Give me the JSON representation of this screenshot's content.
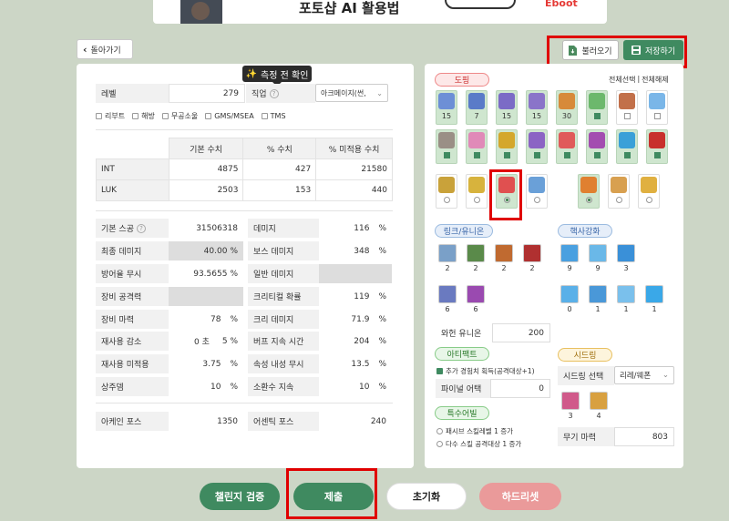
{
  "banner": {
    "title": "포토샵 AI 활용법"
  },
  "nav": {
    "back_label": "돌아가기"
  },
  "toolbar": {
    "load_label": "불러오기",
    "save_label": "저장하기"
  },
  "tooltip": {
    "text": "측정 전 확인"
  },
  "char": {
    "level_label": "레벨",
    "level_value": "279",
    "job_label": "직업",
    "job_value": "아크메이지(썬,",
    "options": [
      "리부트",
      "해방",
      "무공소울",
      "GMS/MSEA",
      "TMS"
    ]
  },
  "stats_table": {
    "headers": [
      "",
      "기본 수치",
      "% 수치",
      "% 미적용 수치"
    ],
    "rows": [
      {
        "name": "INT",
        "base": "4875",
        "pct": "427",
        "flat": "21580"
      },
      {
        "name": "LUK",
        "base": "2503",
        "pct": "153",
        "flat": "440"
      }
    ]
  },
  "left_stats": [
    {
      "label": "기본 스공",
      "value": "31506318",
      "unit": ""
    },
    {
      "label": "최종 데미지",
      "value": "40.00",
      "unit": "%"
    },
    {
      "label": "방어율 무시",
      "value": "93.5655",
      "unit": "%"
    },
    {
      "label": "장비 공격력",
      "value": "",
      "unit": ""
    },
    {
      "label": "장비 마력",
      "value": "78",
      "unit": "%"
    },
    {
      "label": "재사용 감소",
      "value": "0 초",
      "unit": "5 %"
    },
    {
      "label": "재사용 미적용",
      "value": "3.75",
      "unit": "%"
    },
    {
      "label": "상주뎀",
      "value": "10",
      "unit": "%"
    }
  ],
  "right_stats": [
    {
      "label": "데미지",
      "value": "116",
      "unit": "%"
    },
    {
      "label": "보스 데미지",
      "value": "348",
      "unit": "%"
    },
    {
      "label": "일반 데미지",
      "value": "",
      "unit": ""
    },
    {
      "label": "크리티컬 확률",
      "value": "119",
      "unit": "%"
    },
    {
      "label": "크리 데미지",
      "value": "71.9",
      "unit": "%"
    },
    {
      "label": "버프 지속 시간",
      "value": "204",
      "unit": "%"
    },
    {
      "label": "속성 내성 무시",
      "value": "13.5",
      "unit": "%"
    },
    {
      "label": "소환수 지속",
      "value": "10",
      "unit": "%"
    }
  ],
  "force": {
    "arcane_label": "아케인 포스",
    "arcane_value": "1350",
    "authentic_label": "어센틱 포스",
    "authentic_value": "240"
  },
  "doping": {
    "title": "도핑",
    "select_all": "전체선택",
    "sep": "|",
    "deselect_all": "전체해제",
    "row1": [
      {
        "icon": "scroll-icon",
        "count": "15",
        "on": true,
        "color": "#6d8fd6"
      },
      {
        "icon": "scroll-icon",
        "count": "7",
        "on": true,
        "color": "#5a7bc8"
      },
      {
        "icon": "scroll-icon",
        "count": "15",
        "on": true,
        "color": "#7b6bc6"
      },
      {
        "icon": "scroll-icon",
        "count": "15",
        "on": true,
        "color": "#8a74c9"
      },
      {
        "icon": "potion-icon",
        "count": "30",
        "on": true,
        "color": "#d78a3a"
      },
      {
        "icon": "orb-icon",
        "count": "",
        "on": true,
        "color": "#6cb86c"
      },
      {
        "icon": "flower-icon",
        "count": "",
        "on": false,
        "color": "#c2704a"
      },
      {
        "icon": "snow-icon",
        "count": "",
        "on": false,
        "color": "#7ab6e8"
      }
    ],
    "row2": [
      {
        "icon": "armor-icon",
        "on": true,
        "color": "#9a8f86"
      },
      {
        "icon": "pink-icon",
        "on": true,
        "color": "#e08ab8"
      },
      {
        "icon": "gold-icon",
        "on": true,
        "color": "#d4a72c"
      },
      {
        "icon": "box-icon",
        "on": true,
        "color": "#8b64c4"
      },
      {
        "icon": "heart-icon",
        "on": true,
        "color": "#e05a5a"
      },
      {
        "icon": "flask-icon",
        "on": true,
        "color": "#a34db0"
      },
      {
        "icon": "crystal-icon",
        "on": true,
        "color": "#3aa0d8"
      },
      {
        "icon": "vip-icon",
        "on": true,
        "color": "#c8302c"
      }
    ],
    "row3": [
      {
        "icon": "feather-icon",
        "on": false,
        "color": "#c9a23a"
      },
      {
        "icon": "sword-icon",
        "on": false,
        "color": "#d7b33d"
      },
      {
        "icon": "target-icon",
        "on": true,
        "color": "#e05050"
      },
      {
        "icon": "potion-icon",
        "on": false,
        "color": "#6aa0d8"
      },
      {
        "icon": "fish-icon",
        "on": true,
        "color": "#e08030"
      },
      {
        "icon": "rocket-icon",
        "on": false,
        "color": "#d8a050"
      },
      {
        "icon": "bird-icon",
        "on": false,
        "color": "#e0b040"
      }
    ]
  },
  "link": {
    "title": "링크/유니온",
    "row1": [
      {
        "count": "2",
        "color": "#7aa0c8"
      },
      {
        "count": "2",
        "color": "#5a8a4a"
      },
      {
        "count": "2",
        "color": "#c06a30"
      },
      {
        "count": "2",
        "color": "#b03030"
      }
    ],
    "row2": [
      {
        "count": "6",
        "color": "#6a7ac0"
      },
      {
        "count": "6",
        "color": "#9a4ab0"
      }
    ],
    "union_label": "와헌 유니온",
    "union_value": "200"
  },
  "core": {
    "title": "핵사강화",
    "row1": [
      {
        "count": "9",
        "color": "#4aa0e0"
      },
      {
        "count": "9",
        "color": "#6ab8e8"
      },
      {
        "count": "3",
        "color": "#3a90d8"
      }
    ],
    "row2": [
      {
        "count": "0",
        "color": "#5ab0e8"
      },
      {
        "count": "1",
        "color": "#4a98d8"
      },
      {
        "count": "1",
        "color": "#7ac0ec"
      },
      {
        "count": "1",
        "color": "#3aa8e8"
      }
    ]
  },
  "artifact": {
    "title": "아티팩트",
    "check_label": "추가 경험치 획득(공격대상+1)",
    "final_label": "파이널 어택",
    "final_value": "0"
  },
  "special": {
    "title": "특수어빌",
    "opt1": "패시브 스킬레벨 1 증가",
    "opt2": "다수 스킬 공격대상 1 증가"
  },
  "seed": {
    "title": "시드링",
    "select_label": "시드링 선택",
    "select_value": "리레/웨폰",
    "rings": [
      {
        "count": "3",
        "color": "#d05a8a"
      },
      {
        "count": "4",
        "color": "#d8a040"
      }
    ],
    "weapon_label": "무기 마력",
    "weapon_value": "803"
  },
  "actions": {
    "challenge": "챌린지 검증",
    "submit": "제출",
    "reset": "초기화",
    "hard_reset": "하드리셋"
  }
}
